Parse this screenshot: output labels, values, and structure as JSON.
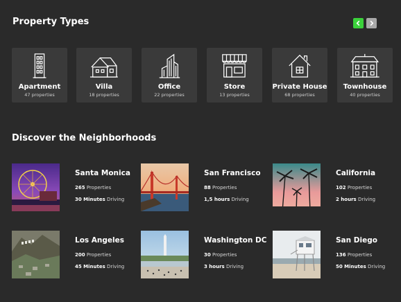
{
  "property_types": {
    "title": "Property Types",
    "nav": {
      "prev_icon": "chevron-left-icon",
      "next_icon": "chevron-right-icon",
      "prev_color": "#3bd13b",
      "next_color": "#a9a9a9"
    },
    "items": [
      {
        "name": "Apartment",
        "count": "47 properties",
        "icon": "apartment-building-icon"
      },
      {
        "name": "Villa",
        "count": "18 properties",
        "icon": "villa-icon"
      },
      {
        "name": "Office",
        "count": "22 properties",
        "icon": "office-building-icon"
      },
      {
        "name": "Store",
        "count": "13 properties",
        "icon": "store-icon"
      },
      {
        "name": "Private House",
        "count": "68 properties",
        "icon": "house-icon"
      },
      {
        "name": "Townhouse",
        "count": "40 properties",
        "icon": "townhouse-icon"
      }
    ]
  },
  "neighborhoods": {
    "title": "Discover the Neighborhoods",
    "items": [
      {
        "name": "Santa Monica",
        "properties_num": "265",
        "properties_label": "Properties",
        "time_num": "30 Minutes",
        "time_label": "Driving"
      },
      {
        "name": "San Francisco",
        "properties_num": "88",
        "properties_label": "Properties",
        "time_num": "1,5 hours",
        "time_label": "Driving"
      },
      {
        "name": "California",
        "properties_num": "102",
        "properties_label": "Properties",
        "time_num": "2 hours",
        "time_label": "Driving"
      },
      {
        "name": "Los Angeles",
        "properties_num": "200",
        "properties_label": "Properties",
        "time_num": "45 Minutes",
        "time_label": "Driving"
      },
      {
        "name": "Washington DC",
        "properties_num": "30",
        "properties_label": "Properties",
        "time_num": "3 hours",
        "time_label": "Driving"
      },
      {
        "name": "San Diego",
        "properties_num": "136",
        "properties_label": "Properties",
        "time_num": "50 Minutes",
        "time_label": "Driving"
      }
    ]
  }
}
